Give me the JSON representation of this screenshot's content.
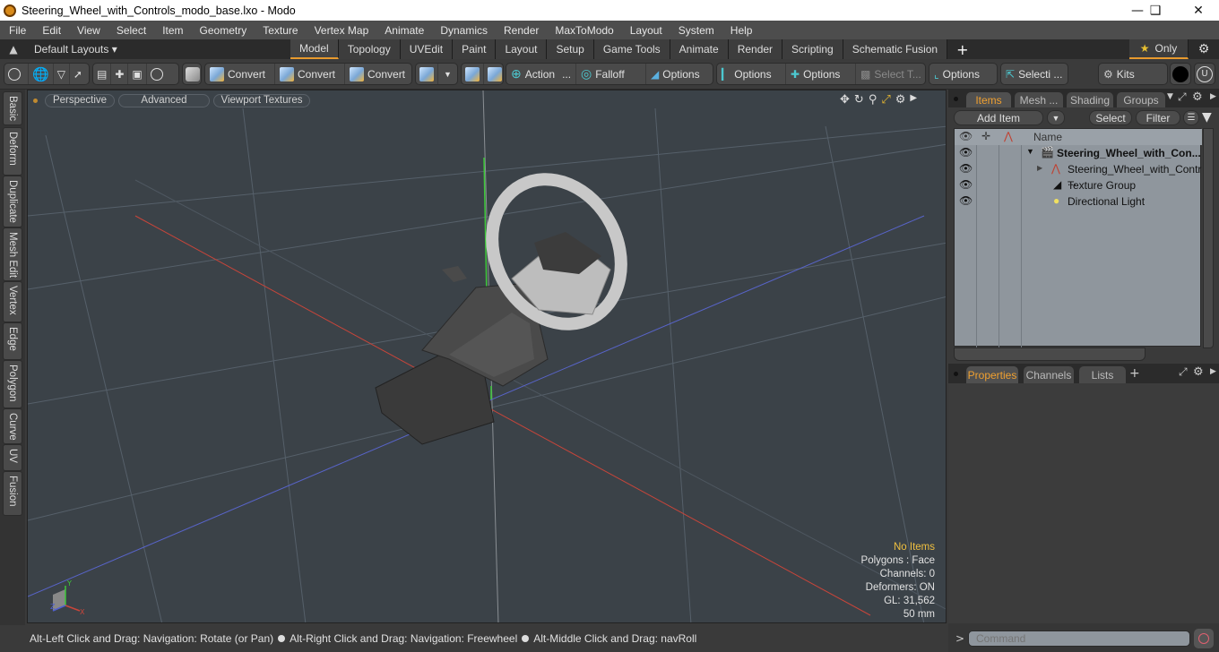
{
  "window": {
    "title": "Steering_Wheel_with_Controls_modo_base.lxo - Modo",
    "controls": [
      "minimize",
      "maximize",
      "close"
    ]
  },
  "menubar": [
    "File",
    "Edit",
    "View",
    "Select",
    "Item",
    "Geometry",
    "Texture",
    "Vertex Map",
    "Animate",
    "Dynamics",
    "Render",
    "MaxToModo",
    "Layout",
    "System",
    "Help"
  ],
  "layoutbar": {
    "layouts_label": "Default Layouts ▾",
    "tabs": [
      "Model",
      "Topology",
      "UVEdit",
      "Paint",
      "Layout",
      "Setup",
      "Game Tools",
      "Animate",
      "Render",
      "Scripting",
      "Schematic Fusion"
    ],
    "active_tab": "Model",
    "add_label": "+",
    "only_label": "Only"
  },
  "toolbar": {
    "convert1": "Convert",
    "convert2": "Convert",
    "convert3": "Convert",
    "action": "Action",
    "action_more": "...",
    "falloff": "Falloff",
    "options1": "Options",
    "options2": "Options",
    "options3": "Options",
    "select_t": "Select T...",
    "options4": "Options",
    "selecti": "Selecti ...",
    "kits": "Kits"
  },
  "left_tabs": [
    "Basic",
    "Deform",
    "Duplicate",
    "Mesh Edit",
    "Vertex",
    "Edge",
    "Polygon",
    "Curve",
    "UV",
    "Fusion"
  ],
  "viewport": {
    "view_mode": "Perspective",
    "shading": "Advanced",
    "textures": "Viewport Textures",
    "hud": {
      "selection": "No Items",
      "polygons": "Polygons : Face",
      "channels": "Channels: 0",
      "deformers": "Deformers: ON",
      "gl": "GL: 31,562",
      "scale": "50 mm"
    },
    "axis_labels": {
      "x": "X",
      "y": "Y",
      "z": "Z"
    }
  },
  "statusbar": {
    "hint1": "Alt-Left Click and Drag: Navigation: Rotate (or Pan)",
    "hint2": "Alt-Right Click and Drag: Navigation: Freewheel",
    "hint3": "Alt-Middle Click and Drag: navRoll"
  },
  "items_panel": {
    "tabs": [
      "Items",
      "Mesh ...",
      "Shading",
      "Groups"
    ],
    "active_tab": "Items",
    "add_item": "Add Item",
    "select": "Select",
    "filter": "Filter",
    "name_header": "Name",
    "rows": [
      {
        "name": "Steering_Wheel_with_Con...",
        "type": "scene",
        "bold": true
      },
      {
        "name": "Steering_Wheel_with_Contr ...",
        "type": "mesh-locator",
        "bold": false
      },
      {
        "name": "Texture Group",
        "type": "texture-group",
        "bold": false
      },
      {
        "name": "Directional Light",
        "type": "light",
        "bold": false
      }
    ]
  },
  "properties_panel": {
    "tabs": [
      "Properties",
      "Channels",
      "Lists"
    ],
    "active_tab": "Properties",
    "add_label": "+"
  },
  "command": {
    "prompt": ">",
    "placeholder": "Command"
  },
  "colors": {
    "accent": "#e89a2e",
    "x_axis": "#c8453a",
    "y_axis": "#3ec83a",
    "z_axis": "#5060d0"
  }
}
